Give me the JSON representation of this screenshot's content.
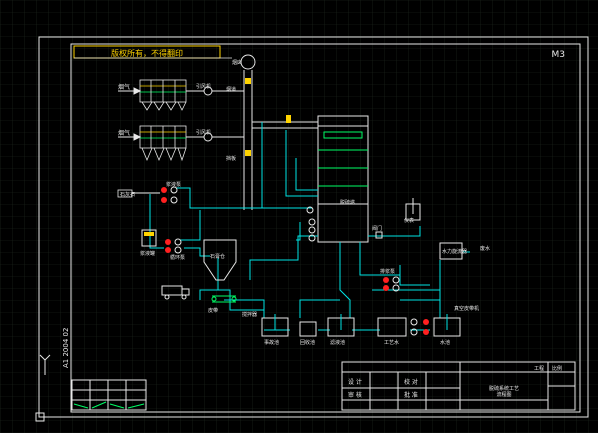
{
  "drawing": {
    "banner": "版权所有，不得翻印",
    "sheet_no": "M3",
    "side_label": "A1 2004 02",
    "labels": {
      "duct_top": "烟气",
      "duct_lower": "烟气",
      "fan_1": "引风机",
      "fan_2": "引风机",
      "tower": "脱硫塔",
      "reagent": "石灰石",
      "reagent_tank": "浆液罐",
      "silo": "石膏仓",
      "pump_row_1": "浆液泵",
      "pump_row_2": "循环泵",
      "lower_pumps": "排浆泵",
      "tank_1": "事故池",
      "tank_2": "回收池",
      "tank_3": "滤液池",
      "tank_4": "工艺水",
      "tank_5": "水池",
      "right_box": "水力旋流器",
      "right_out": "废水",
      "right_label": "真空皮带机",
      "stack": "烟囱",
      "valve_1": "烟道",
      "valve_2": "挡板",
      "agitator": "搅拌器",
      "conveyor": "皮带",
      "ins1": "阀门",
      "ins2": "仪表"
    },
    "title_block": {
      "c1": "设 计",
      "c2": "校 对",
      "c3": "审 核",
      "c4": "批 准",
      "title": "脱硫系统工艺",
      "subtitle": "流程图",
      "fig_no": "工程",
      "scale": "比例"
    }
  }
}
